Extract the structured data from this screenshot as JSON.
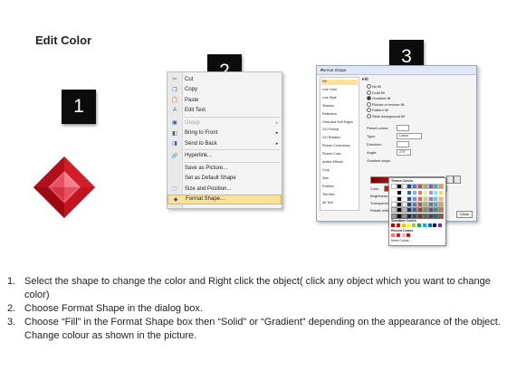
{
  "title": "Edit Color",
  "steps": [
    "1",
    "2",
    "3"
  ],
  "context_menu": {
    "items": [
      {
        "label": "Cut",
        "icon": "cut-icon",
        "enabled": true,
        "arrow": false
      },
      {
        "label": "Copy",
        "icon": "copy-icon",
        "enabled": true,
        "arrow": false
      },
      {
        "label": "Paste",
        "icon": "paste-icon",
        "enabled": true,
        "arrow": false
      },
      {
        "label": "Edit Text",
        "icon": "edit-text-icon",
        "enabled": true,
        "arrow": false
      },
      {
        "label": "Group",
        "icon": "group-icon",
        "enabled": false,
        "arrow": true
      },
      {
        "label": "Bring to Front",
        "icon": "bring-front-icon",
        "enabled": true,
        "arrow": true
      },
      {
        "label": "Send to Back",
        "icon": "send-back-icon",
        "enabled": true,
        "arrow": true
      },
      {
        "label": "Hyperlink...",
        "icon": "hyperlink-icon",
        "enabled": true,
        "arrow": false
      },
      {
        "label": "Save as Picture...",
        "icon": "",
        "enabled": true,
        "arrow": false
      },
      {
        "label": "Set as Default Shape",
        "icon": "",
        "enabled": true,
        "arrow": false
      },
      {
        "label": "Size and Position...",
        "icon": "size-icon",
        "enabled": true,
        "arrow": false
      },
      {
        "label": "Format Shape...",
        "icon": "format-shape-icon",
        "enabled": true,
        "arrow": false,
        "highlighted": true
      }
    ]
  },
  "format_dialog": {
    "title": "Format Shape",
    "close_glyph": "✕",
    "side_items": [
      "Fill",
      "Line Color",
      "Line Style",
      "Shadow",
      "Reflection",
      "Glow and Soft Edges",
      "3-D Format",
      "3-D Rotation",
      "Picture Corrections",
      "Picture Color",
      "Artistic Effects",
      "Crop",
      "Size",
      "Position",
      "Text Box",
      "Alt Text"
    ],
    "heading": "Fill",
    "fill_options": [
      "No fill",
      "Solid fill",
      "Gradient fill",
      "Picture or texture fill",
      "Pattern fill",
      "Slide background fill"
    ],
    "selected_fill": "Gradient fill",
    "fields": {
      "preset": "Preset colors:",
      "type": "Type:",
      "type_value": "Linear",
      "direction": "Direction:",
      "angle": "Angle:",
      "angle_value": "270°",
      "gradient_stops": "Gradient stops",
      "color": "Color",
      "position": "Position:",
      "position_value": "0%",
      "brightness": "Brightness:",
      "transparency": "Transparency:",
      "rotate": "Rotate with shape"
    },
    "palette": {
      "theme_colors": "Theme Colors",
      "standard_colors": "Standard Colors",
      "recent_colors": "Recent Colors",
      "more_colors": "More Colors..."
    },
    "close_button": "Close"
  },
  "colors": {
    "diamond_dark": "#8b0000",
    "diamond_mid": "#c8141e",
    "diamond_light": "#ef5a6a",
    "highlight": "#fbe29a",
    "step_box": "#0c0c0c"
  },
  "instructions": [
    {
      "num": "1.",
      "text": "Select the shape to change the color and Right click the object( click any object which you want to change color)"
    },
    {
      "num": "2.",
      "text": "Choose Format Shape in the dialog box."
    },
    {
      "num": "3.",
      "text": "Choose “Fill” in the Format Shape box then “Solid” or “Gradient” depending on the appearance of the object. Change colour as shown in the picture."
    }
  ]
}
